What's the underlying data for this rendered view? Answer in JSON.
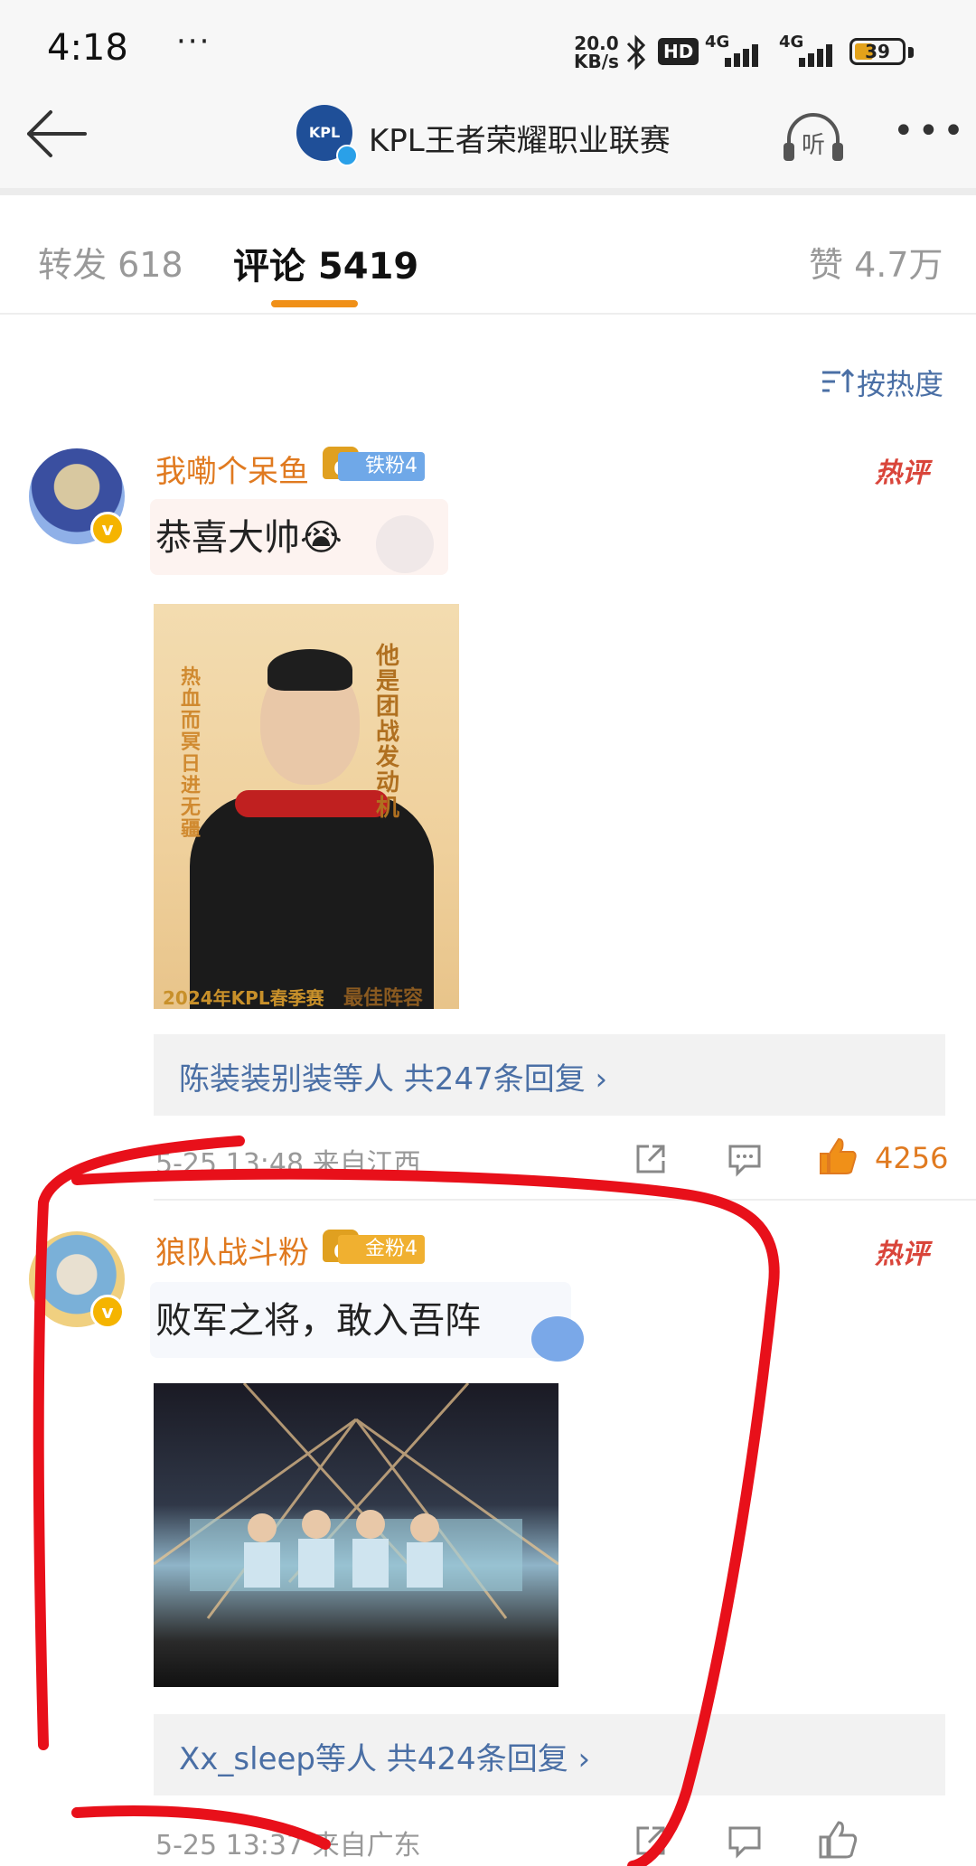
{
  "status_bar": {
    "time": "4:18",
    "dots": "···",
    "speed_value": "20.0",
    "speed_unit": "KB/s",
    "hd": "HD",
    "net1": "4G",
    "net2": "4G",
    "battery": "39"
  },
  "header": {
    "title": "KPL王者荣耀职业联赛",
    "logo_text": "KPL",
    "listen_label": "听"
  },
  "tabs": {
    "repost_label": "转发 618",
    "comments_label": "评论 5419",
    "likes_label": "赞 4.7万"
  },
  "sort": {
    "label": "按热度"
  },
  "comments": [
    {
      "username": "我嘞个呆鱼",
      "level": "6",
      "fan_badge": "铁粉4",
      "hot_label": "热评",
      "text": "恭喜大帅😭",
      "image_caption_right": "他是团战发动机",
      "image_caption_left": "热血而冥 日进无疆",
      "image_footer_year": "2024年KPL春季赛",
      "image_footer_title": "最佳阵容",
      "replies": "陈装装别装等人  共247条回复 ›",
      "time_location": "5-25 13:48  来自江西",
      "likes": "4256"
    },
    {
      "username": "狼队战斗粉",
      "level": "6",
      "fan_badge": "金粉4",
      "hot_label": "热评",
      "text": "败军之将，敢入吾阵",
      "replies": "Xx_sleep等人  共424条回复 ›",
      "time_location": "5-25 13:37 来自广东"
    }
  ],
  "colors": {
    "accent": "#f09018",
    "username": "#e07a20",
    "link": "#4a6fa5",
    "hot": "#d9453a",
    "annotation": "#e8101a"
  }
}
